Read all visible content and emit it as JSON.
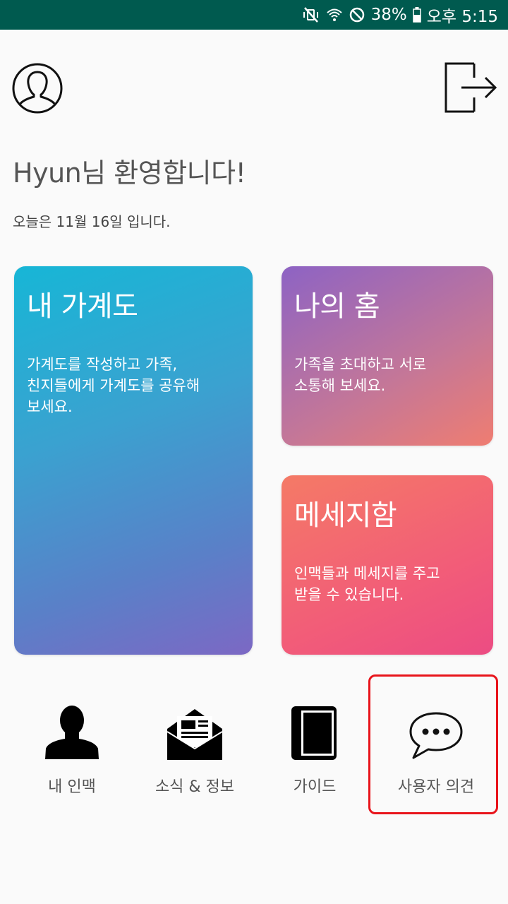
{
  "status_bar": {
    "battery": "38%",
    "time": "오후 5:15",
    "icons": [
      "mute-vibrate-icon",
      "wifi-icon",
      "do-not-disturb-icon",
      "battery-icon"
    ]
  },
  "header": {
    "profile_icon": "person-outline-icon",
    "logout_icon": "logout-icon"
  },
  "welcome": {
    "greeting": "Hyun님 환영합니다!",
    "date_text": "오늘은 11월 16일 입니다."
  },
  "cards": {
    "family_tree": {
      "title": "내 가계도",
      "description": "가계도를 작성하고 가족,\n친지들에게 가계도를 공유해\n보세요."
    },
    "my_home": {
      "title": "나의 홈",
      "description": "가족을 초대하고 서로\n소통해 보세요."
    },
    "messages": {
      "title": "메세지함",
      "description": "인맥들과 메세지를 주고\n받을 수 있습니다."
    }
  },
  "bottom_nav": {
    "contacts": {
      "label": "내 인맥",
      "icon": "person-silhouette-icon"
    },
    "news": {
      "label": "소식 & 정보",
      "icon": "newsletter-icon"
    },
    "guide": {
      "label": "가이드",
      "icon": "book-icon"
    },
    "feedback": {
      "label": "사용자 의견",
      "icon": "chat-bubble-icon"
    }
  },
  "colors": {
    "status_bar": "#005a4f",
    "background": "#fafafa",
    "highlight": "#e8141b"
  }
}
